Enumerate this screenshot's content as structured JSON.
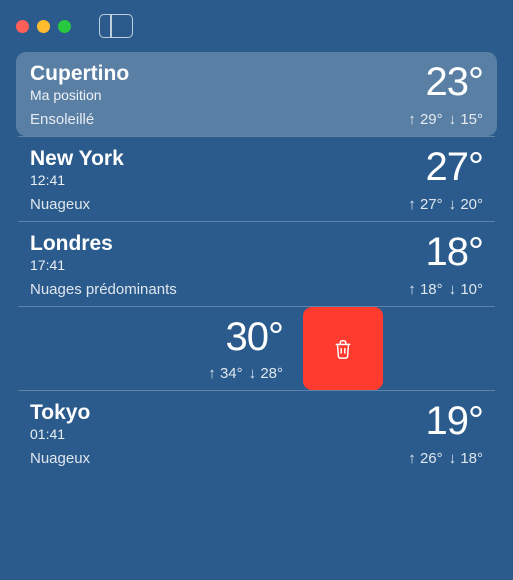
{
  "locations": [
    {
      "city": "Cupertino",
      "subtitle": "Ma position",
      "temp": "23°",
      "condition": "Ensoleillé",
      "high": "29°",
      "low": "15°",
      "selected": true
    },
    {
      "city": "New York",
      "subtitle": "12:41",
      "temp": "27°",
      "condition": "Nuageux",
      "high": "27°",
      "low": "20°"
    },
    {
      "city": "Londres",
      "subtitle": "17:41",
      "temp": "18°",
      "condition": "Nuages prédominants",
      "high": "18°",
      "low": "10°"
    },
    {
      "city": "",
      "subtitle": "",
      "temp": "30°",
      "condition": "",
      "high": "34°",
      "low": "28°",
      "swiped": true
    },
    {
      "city": "Tokyo",
      "subtitle": "01:41",
      "temp": "19°",
      "condition": "Nuageux",
      "high": "26°",
      "low": "18°"
    }
  ]
}
